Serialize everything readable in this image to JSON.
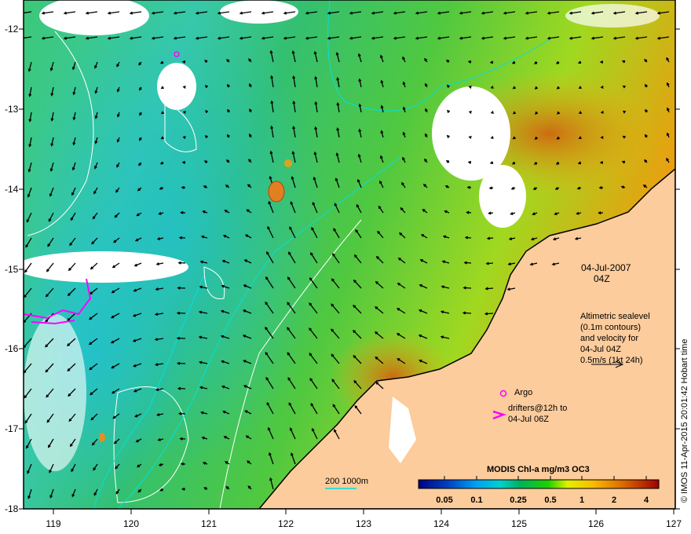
{
  "map": {
    "lon_ticks": [
      "119",
      "120",
      "121",
      "122",
      "123",
      "124",
      "125",
      "126",
      "127"
    ],
    "lat_ticks": [
      "-12",
      "-13",
      "-14",
      "-15",
      "-16",
      "-17",
      "-18"
    ],
    "lon_range": [
      118.65,
      127
    ],
    "lat_range": [
      -11.64,
      -18
    ],
    "colors": {
      "land": "#fccc9c",
      "cloud": "#ffffff",
      "contour": "#ffffff",
      "isobath": "#00e0e0",
      "argo": "#ff00ff",
      "drifter": "#ff00ff"
    }
  },
  "annotations": {
    "date": "04-Jul-2007",
    "time": "04Z",
    "legend_lines": [
      "Altimetric sealevel",
      "(0.1m contours)",
      "and velocity for",
      "04-Jul 04Z",
      "0.5m/s (1kt 24h)"
    ],
    "argo_label": "Argo",
    "drifters_lines": [
      "drifters@12h to",
      "04-Jul 06Z"
    ],
    "isobath_label": "200  1000m",
    "credit": "© IMOS 11-Apr-2015 20:01:42 Hobart time"
  },
  "colorbar": {
    "title": "MODIS Chl-a mg/m3 OC3",
    "ticks": [
      "0.05",
      "0.1",
      "0.25",
      "0.5",
      "1",
      "2",
      "4"
    ]
  }
}
